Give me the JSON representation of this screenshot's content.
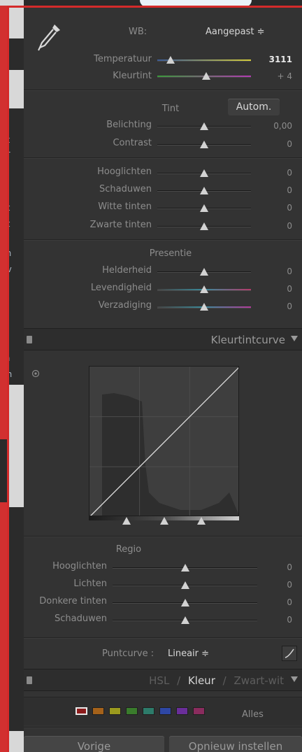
{
  "background_fragments": [
    "at",
    "ur",
    "ht",
    "nt",
    "ch",
    "uv",
    "in",
    "in",
    "rh",
    "gh"
  ],
  "wb": {
    "label": "WB:",
    "value": "Aangepast ≑"
  },
  "basic": {
    "temperature": {
      "label": "Temperatuur",
      "value": "3111",
      "level": 0.14
    },
    "tint": {
      "label": "Kleurtint",
      "value": "+ 4",
      "level": 0.52
    },
    "tone_title": "Tint",
    "auto_label": "Autom.",
    "exposure": {
      "label": "Belichting",
      "value": "0,00",
      "level": 0.5
    },
    "contrast": {
      "label": "Contrast",
      "value": "0",
      "level": 0.5
    },
    "highlights": {
      "label": "Hooglichten",
      "value": "0",
      "level": 0.5
    },
    "shadows": {
      "label": "Schaduwen",
      "value": "0",
      "level": 0.5
    },
    "whites": {
      "label": "Witte tinten",
      "value": "0",
      "level": 0.5
    },
    "blacks": {
      "label": "Zwarte tinten",
      "value": "0",
      "level": 0.5
    },
    "presence_title": "Presentie",
    "clarity": {
      "label": "Helderheid",
      "value": "0",
      "level": 0.5
    },
    "vibrance": {
      "label": "Levendigheid",
      "value": "0",
      "level": 0.5
    },
    "saturation": {
      "label": "Verzadiging",
      "value": "0",
      "level": 0.5
    }
  },
  "tone_curve": {
    "title": "Kleurtintcurve",
    "region_title": "Regio",
    "highlights": {
      "label": "Hooglichten",
      "value": "0",
      "level": 0.5
    },
    "lights": {
      "label": "Lichten",
      "value": "0",
      "level": 0.5
    },
    "darks": {
      "label": "Donkere tinten",
      "value": "0",
      "level": 0.5
    },
    "shadows": {
      "label": "Schaduwen",
      "value": "0",
      "level": 0.5
    },
    "point_curve_label": "Puntcurve :",
    "point_curve_value": "Lineair ≑"
  },
  "hsl_header": {
    "hsl": "HSL",
    "sep1": "/",
    "color": "Kleur",
    "sep2": "/",
    "bw": "Zwart-wit"
  },
  "color_swatches": [
    "#8c1c1c",
    "#a5621a",
    "#9b9a1e",
    "#3a7c2c",
    "#2d7b6a",
    "#2e47a4",
    "#6a2e9a",
    "#8a2c5e"
  ],
  "all_label": "Alles",
  "buttons": {
    "previous": "Vorige",
    "reset": "Opnieuw instellen"
  }
}
